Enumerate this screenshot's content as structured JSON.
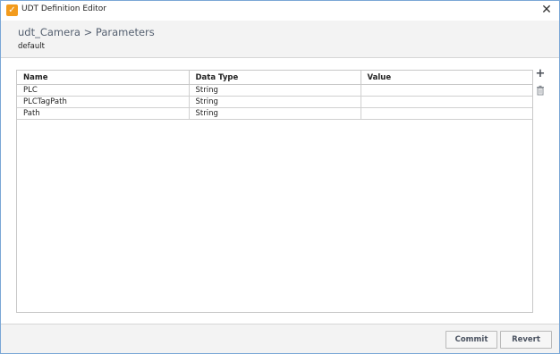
{
  "window": {
    "title": "UDT Definition Editor",
    "close_glyph": "✕",
    "app_icon_glyph": "✓"
  },
  "header": {
    "breadcrumb": "udt_Camera > Parameters",
    "subtitle": "default"
  },
  "table": {
    "columns": [
      "Name",
      "Data Type",
      "Value"
    ],
    "rows": [
      {
        "name": "PLC",
        "data_type": "String",
        "value": ""
      },
      {
        "name": "PLCTagPath",
        "data_type": "String",
        "value": ""
      },
      {
        "name": "Path",
        "data_type": "String",
        "value": ""
      }
    ]
  },
  "tools": {
    "add_glyph": "+"
  },
  "footer": {
    "commit_label": "Commit",
    "revert_label": "Revert"
  },
  "colors": {
    "accent": "#f29b1d",
    "border": "#7aa7d6"
  },
  "icons": {
    "app": "checkmark-icon",
    "close": "close-icon",
    "add": "plus-icon",
    "delete": "trash-icon"
  }
}
